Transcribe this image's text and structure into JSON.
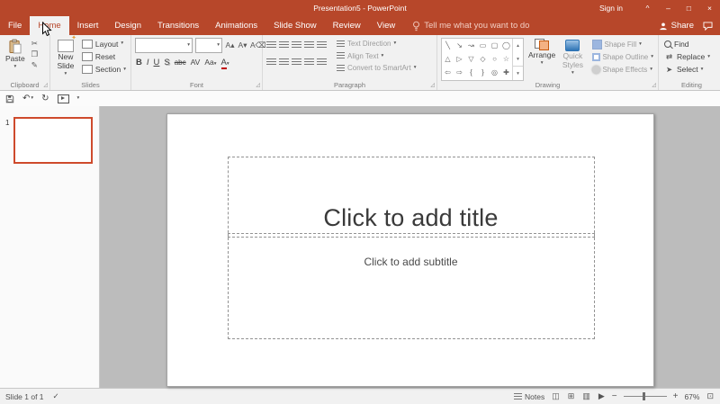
{
  "window": {
    "title": "Presentation5 - PowerPoint",
    "sign_in": "Sign in"
  },
  "tabrow": {
    "tabs": [
      {
        "id": "file",
        "label": "File",
        "active": false
      },
      {
        "id": "home",
        "label": "Home",
        "active": true
      },
      {
        "id": "insert",
        "label": "Insert",
        "active": false
      },
      {
        "id": "design",
        "label": "Design",
        "active": false
      },
      {
        "id": "transitions",
        "label": "Transitions",
        "active": false
      },
      {
        "id": "animations",
        "label": "Animations",
        "active": false
      },
      {
        "id": "slideshow",
        "label": "Slide Show",
        "active": false
      },
      {
        "id": "review",
        "label": "Review",
        "active": false
      },
      {
        "id": "view",
        "label": "View",
        "active": false
      }
    ],
    "tell_me": "Tell me what you want to do",
    "share": "Share"
  },
  "ribbon": {
    "clipboard": {
      "label": "Clipboard",
      "paste": "Paste"
    },
    "slides": {
      "label": "Slides",
      "new_slide": "New Slide",
      "layout": "Layout",
      "reset": "Reset",
      "section": "Section"
    },
    "font": {
      "label": "Font",
      "font_name": "",
      "font_size": ""
    },
    "paragraph": {
      "label": "Paragraph",
      "text_direction": "Text Direction",
      "align_text": "Align Text",
      "smartart": "Convert to SmartArt"
    },
    "drawing": {
      "label": "Drawing",
      "arrange": "Arrange",
      "quick_styles": "Quick Styles",
      "shape_fill": "Shape Fill",
      "shape_outline": "Shape Outline",
      "shape_effects": "Shape Effects",
      "shapes_rows": [
        [
          "╲",
          "↘",
          "↝",
          "▭",
          "▢",
          "◯"
        ],
        [
          "△",
          "▷",
          "▽",
          "◇",
          "○",
          "☆"
        ],
        [
          "⇦",
          "⇨",
          "{",
          "}",
          "◎",
          "✚"
        ]
      ]
    },
    "editing": {
      "label": "Editing",
      "find": "Find",
      "replace": "Replace",
      "select": "Select"
    }
  },
  "slide": {
    "title_placeholder": "Click to add title",
    "subtitle_placeholder": "Click to add subtitle"
  },
  "thumbnail_panel": {
    "slides": [
      {
        "number": "1"
      }
    ]
  },
  "statusbar": {
    "slide_indicator": "Slide 1 of 1",
    "notes_label": "Notes",
    "zoom_value": "67%"
  },
  "icons": {
    "cut": "✂",
    "copy": "❐",
    "format_painter": "✎",
    "grow_font": "A▴",
    "shrink_font": "A▾",
    "clear_formatting": "A⌫",
    "bold": "B",
    "italic": "I",
    "underline": "U",
    "text_shadow": "S",
    "strikethrough": "abc",
    "char_spacing": "AV",
    "change_case": "Aa",
    "font_color": "A",
    "undo": "↶",
    "redo": "↻",
    "dropdown": "▾",
    "scroll_up": "▴",
    "scroll_down": "▾",
    "shapes_more": "▾",
    "launcher": "◿",
    "replace": "⇄",
    "select": "➤",
    "view_normal": "◫",
    "view_sorter": "⊞",
    "view_reading": "▥",
    "view_slideshow": "▶",
    "zoom_out": "−",
    "zoom_in": "+",
    "fit_window": "⊡",
    "spell_check": "✓",
    "minimize": "–",
    "maximize": "□",
    "close": "×",
    "ribbon_options": "^"
  }
}
